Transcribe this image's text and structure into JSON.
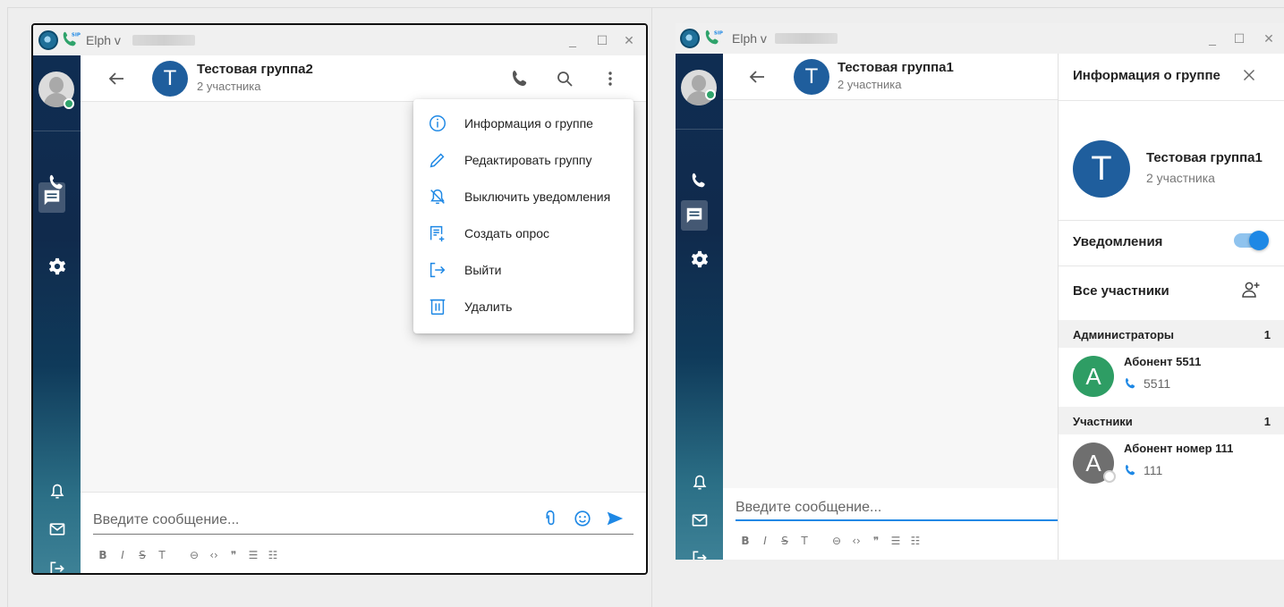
{
  "colors": {
    "accent": "#1e88e5",
    "group_avatar": "#1f5e9d",
    "sidebar_top": "#0f2d52",
    "sidebar_bottom": "#3d8196",
    "admin_avatar": "#2e9d64",
    "member_avatar": "#6f6f6f",
    "online": "#2fa36b"
  },
  "left_window": {
    "titlebar": {
      "title": "Elph v",
      "phone_badge": "SIP",
      "minimize": "_",
      "maximize": "☐",
      "close": "✕"
    },
    "sidebar": {
      "icons": [
        "user-avatar",
        "phone-icon",
        "chat-icon",
        "gear-icon",
        "bell-icon",
        "mail-icon",
        "logout-icon"
      ]
    },
    "header": {
      "avatar_letter": "T",
      "title": "Тестовая группа2",
      "subtitle": "2 участника"
    },
    "menu": {
      "items": [
        {
          "label": "Информация о группе",
          "icon": "info-icon"
        },
        {
          "label": "Редактировать группу",
          "icon": "pencil-icon"
        },
        {
          "label": "Выключить уведомления",
          "icon": "bell-off-icon"
        },
        {
          "label": "Создать опрос",
          "icon": "poll-icon"
        },
        {
          "label": "Выйти",
          "icon": "exit-icon"
        },
        {
          "label": "Удалить",
          "icon": "trash-icon"
        }
      ]
    },
    "composer": {
      "placeholder": "Введите сообщение..."
    },
    "format": [
      "B",
      "I",
      "S",
      "T",
      "⊖",
      "‹›",
      "❞",
      "☰",
      "☷"
    ]
  },
  "right_window": {
    "titlebar": {
      "title": "Elph v",
      "phone_badge": "SIP",
      "minimize": "_",
      "maximize": "☐",
      "close": "✕"
    },
    "header": {
      "avatar_letter": "T",
      "title": "Тестовая группа1",
      "subtitle": "2 участника"
    },
    "composer": {
      "placeholder": "Введите сообщение..."
    },
    "format": [
      "B",
      "I",
      "S",
      "T",
      "⊖",
      "‹›",
      "❞",
      "☰",
      "☷"
    ],
    "info": {
      "title": "Информация о группе",
      "group_letter": "T",
      "group_name": "Тестовая группа1",
      "group_sub": "2 участника",
      "notifications_label": "Уведомления",
      "notifications_on": true,
      "all_members_label": "Все участники",
      "admins_label": "Администраторы",
      "admins_count": "1",
      "admins": [
        {
          "letter": "A",
          "name": "Абонент 5511",
          "number": "5511"
        }
      ],
      "members_label": "Участники",
      "members_count": "1",
      "members": [
        {
          "letter": "A",
          "name": "Абонент номер 111",
          "number": "111"
        }
      ]
    }
  }
}
